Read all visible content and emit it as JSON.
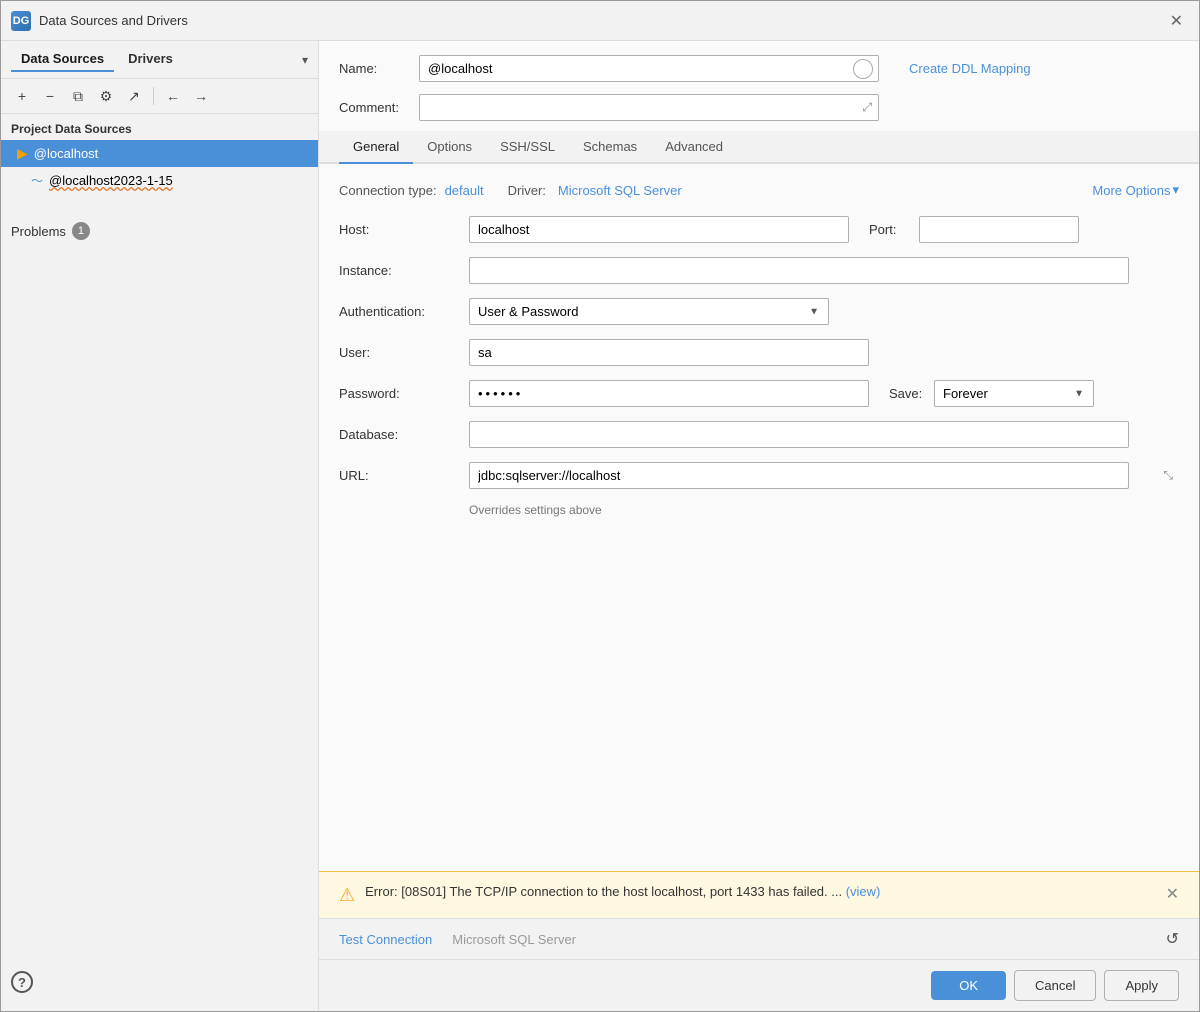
{
  "window": {
    "title": "Data Sources and Drivers",
    "icon_label": "DG",
    "close_label": "✕"
  },
  "left_panel": {
    "tab_data_sources": "Data Sources",
    "tab_drivers": "Drivers",
    "toolbar": {
      "add_label": "+",
      "remove_label": "−",
      "copy_label": "⧉",
      "settings_label": "⚙",
      "export_label": "↗",
      "back_label": "←",
      "forward_label": "→"
    },
    "section_label": "Project Data Sources",
    "items": [
      {
        "label": "@localhost",
        "icon": "▶",
        "selected": true
      },
      {
        "label": "@localhost2023-1-15",
        "icon": "~",
        "selected": false,
        "wavy": true
      }
    ],
    "problems_label": "Problems",
    "problems_count": "1",
    "help_label": "?"
  },
  "right_panel": {
    "name_label": "Name:",
    "name_value": "@localhost",
    "create_ddl_label": "Create DDL Mapping",
    "comment_label": "Comment:",
    "comment_value": "",
    "tabs": [
      {
        "label": "General",
        "active": true
      },
      {
        "label": "Options",
        "active": false
      },
      {
        "label": "SSH/SSL",
        "active": false
      },
      {
        "label": "Schemas",
        "active": false
      },
      {
        "label": "Advanced",
        "active": false
      }
    ],
    "conn_type_label": "Connection type:",
    "conn_type_value": "default",
    "driver_label": "Driver:",
    "driver_value": "Microsoft SQL Server",
    "more_options_label": "More Options",
    "host_label": "Host:",
    "host_value": "localhost",
    "port_label": "Port:",
    "port_value": "",
    "instance_label": "Instance:",
    "instance_value": "",
    "auth_label": "Authentication:",
    "auth_value": "User & Password",
    "user_label": "User:",
    "user_value": "sa",
    "password_label": "Password:",
    "password_value": "••••••",
    "save_label": "Save:",
    "save_value": "Forever",
    "database_label": "Database:",
    "database_value": "",
    "url_label": "URL:",
    "url_value": "jdbc:sqlserver://localhost",
    "url_note": "Overrides settings above",
    "error": {
      "icon": "⚠",
      "text": "Error: [08S01] The TCP/IP connection to the host localhost, port 1433 has failed. ...",
      "link_label": "(view)",
      "close_label": "✕"
    },
    "bottom": {
      "test_connection_label": "Test Connection",
      "driver_label": "Microsoft SQL Server",
      "refresh_label": "↺"
    },
    "actions": {
      "ok_label": "OK",
      "cancel_label": "Cancel",
      "apply_label": "Apply"
    }
  }
}
